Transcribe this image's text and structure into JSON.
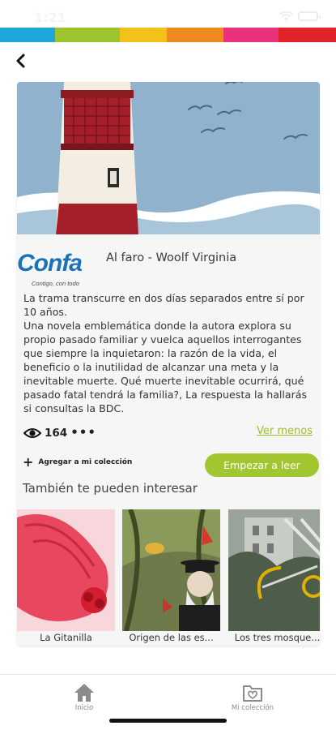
{
  "status_bar": {
    "time": "1:21"
  },
  "color_strip": [
    "#1ea7d8",
    "#9dc42e",
    "#f2c21b",
    "#ef8a1e",
    "#e8327c",
    "#e3232b"
  ],
  "book": {
    "title": "Al faro - Woolf Virginia",
    "publisher_logo_text": "Confa",
    "publisher_tagline": "Contigo, con todo",
    "description": [
      "La trama  transcurre en dos días separados entre sí por 10 años.",
      "Una novela emblemática donde la autora explora su propio pasado familiar y vuelca aquellos interrogantes que siempre la inquietaron: la razón de la vida, el beneficio o la inutilidad de alcanzar una meta y la inevitable muerte.     Qué muerte inevitable ocurrirá, qué pasado fatal tendrá la familia?, La respuesta la hallarás si consultas la BDC."
    ],
    "views": "164",
    "more": "•••",
    "ver_menos": "Ver menos",
    "add_collection": "Agregar a mi colección",
    "start_reading": "Empezar a leer"
  },
  "recommendations": {
    "title": "También te pueden interesar",
    "items": [
      {
        "label": "La Gitanilla"
      },
      {
        "label": "Origen de las es..."
      },
      {
        "label": "Los tres mosque..."
      }
    ]
  },
  "tab_bar": {
    "home": "Inicio",
    "collection": "Mi colección"
  },
  "colors": {
    "accent": "#a2c62f",
    "link": "#9bbd29",
    "brand_blue": "#1c72b8"
  }
}
